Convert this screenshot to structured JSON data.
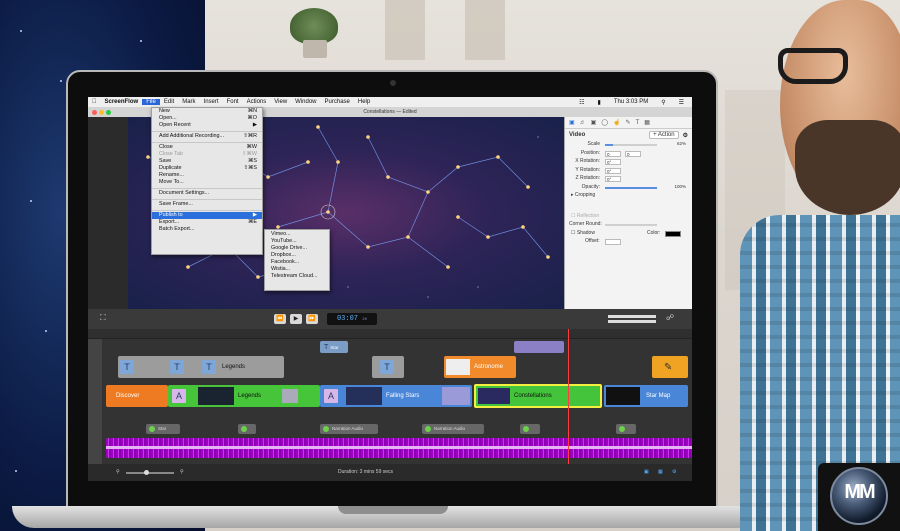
{
  "menubar": {
    "app": "ScreenFlow",
    "items": [
      "File",
      "Edit",
      "Mark",
      "Insert",
      "Font",
      "Actions",
      "View",
      "Window",
      "Purchase",
      "Help"
    ],
    "time": "Thu 3:03 PM"
  },
  "window": {
    "title": "Constellations — Edited"
  },
  "file_menu": {
    "items": [
      {
        "label": "New",
        "shortcut": "⌘N"
      },
      {
        "label": "Open...",
        "shortcut": "⌘O"
      },
      {
        "label": "Open Recent",
        "shortcut": "▶"
      },
      {
        "label": "Add Additional Recording...",
        "shortcut": "⇧⌘R"
      },
      {
        "label": "Close",
        "shortcut": "⌘W"
      },
      {
        "label": "Close Tab",
        "shortcut": "⇧⌘W"
      },
      {
        "label": "Save",
        "shortcut": "⌘S"
      },
      {
        "label": "Duplicate",
        "shortcut": "⇧⌘S"
      },
      {
        "label": "Rename...",
        "shortcut": ""
      },
      {
        "label": "Move To...",
        "shortcut": ""
      },
      {
        "label": "Document Settings...",
        "shortcut": ""
      },
      {
        "label": "Save Frame...",
        "shortcut": ""
      },
      {
        "label": "Publish to",
        "shortcut": "▶"
      },
      {
        "label": "Export...",
        "shortcut": "⌘E"
      },
      {
        "label": "Batch Export...",
        "shortcut": ""
      }
    ]
  },
  "publish_submenu": {
    "items": [
      "Vimeo...",
      "YouTube...",
      "Google Drive...",
      "Dropbox...",
      "Facebook...",
      "Wistia...",
      "Telestream Cloud..."
    ]
  },
  "inspector": {
    "section": "Video",
    "action_button": "+ Action",
    "scale_label": "Scale",
    "scale_value": "62%",
    "position_label": "Position:",
    "position_x": "0",
    "position_y": "0",
    "xrot_label": "X Rotation:",
    "xrot": "0°",
    "yrot_label": "Y Rotation:",
    "yrot": "0°",
    "zrot_label": "Z Rotation:",
    "zrot": "0°",
    "opacity_label": "Opacity:",
    "opacity_value": "100%",
    "cropping": "Cropping",
    "reflection": "Reflection",
    "corner_round": "Corner Round:",
    "shadow": "Shadow",
    "color_label": "Color:",
    "offset_label": "Offset:"
  },
  "controls": {
    "timecode": "03:07",
    "timecode_frames": "20"
  },
  "timeline": {
    "title_clips": [
      "Legends",
      "Astronome"
    ],
    "video_clips": [
      "Discover",
      "Legends",
      "Falling Stars",
      "Constellations",
      "Star Map"
    ],
    "small_tags": [
      "Star"
    ],
    "audio_clips": [
      "Narration Audio",
      "Narration Audio"
    ]
  },
  "status": {
    "duration": "Duration: 3 mins 59 secs"
  },
  "brand": {
    "logo_text": "MM",
    "accent": "#2a6fdc"
  }
}
